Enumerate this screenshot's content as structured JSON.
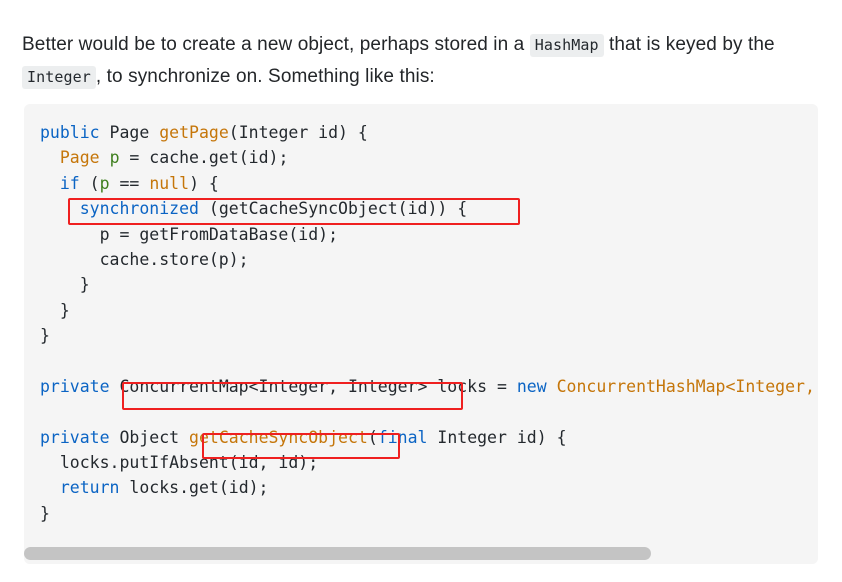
{
  "paragraph": {
    "part1": "Better would be to create a new object, perhaps stored in a ",
    "code1": "HashMap",
    "part2": " that is keyed by the ",
    "code2": "Integer",
    "part3": ", to synchronize on. Something like this:"
  },
  "code_block": {
    "language": "java",
    "lines": [
      {
        "tokens": [
          {
            "t": "public",
            "c": "kw"
          },
          {
            "t": " ",
            "c": "pln"
          },
          {
            "t": "Page",
            "c": "pln"
          },
          {
            "t": " ",
            "c": "pln"
          },
          {
            "t": "getPage",
            "c": "fn"
          },
          {
            "t": "(Integer id) {",
            "c": "pln"
          }
        ]
      },
      {
        "tokens": [
          {
            "t": "  ",
            "c": "pln"
          },
          {
            "t": "Page",
            "c": "typ"
          },
          {
            "t": " ",
            "c": "pln"
          },
          {
            "t": "p",
            "c": "var"
          },
          {
            "t": " = cache.get(id);",
            "c": "pln"
          }
        ]
      },
      {
        "tokens": [
          {
            "t": "  ",
            "c": "pln"
          },
          {
            "t": "if",
            "c": "kw"
          },
          {
            "t": " (",
            "c": "pln"
          },
          {
            "t": "p",
            "c": "var"
          },
          {
            "t": " == ",
            "c": "pln"
          },
          {
            "t": "null",
            "c": "typ"
          },
          {
            "t": ") {",
            "c": "pln"
          }
        ]
      },
      {
        "tokens": [
          {
            "t": "    ",
            "c": "pln"
          },
          {
            "t": "synchronized",
            "c": "kw"
          },
          {
            "t": " (getCacheSyncObject(id)) {",
            "c": "pln"
          }
        ]
      },
      {
        "tokens": [
          {
            "t": "      p = getFromDataBase(id);",
            "c": "pln"
          }
        ]
      },
      {
        "tokens": [
          {
            "t": "      cache.store(p);",
            "c": "pln"
          }
        ]
      },
      {
        "tokens": [
          {
            "t": "    }",
            "c": "pln"
          }
        ]
      },
      {
        "tokens": [
          {
            "t": "  }",
            "c": "pln"
          }
        ]
      },
      {
        "tokens": [
          {
            "t": "}",
            "c": "pln"
          }
        ]
      },
      {
        "tokens": [
          {
            "t": "",
            "c": "pln"
          }
        ]
      },
      {
        "tokens": [
          {
            "t": "private",
            "c": "kw"
          },
          {
            "t": " ConcurrentMap<Integer, Integer> locks = ",
            "c": "pln"
          },
          {
            "t": "new",
            "c": "kw"
          },
          {
            "t": " ",
            "c": "pln"
          },
          {
            "t": "ConcurrentHashMap<Integer, Integer>();",
            "c": "typ"
          }
        ]
      },
      {
        "tokens": [
          {
            "t": "",
            "c": "pln"
          }
        ]
      },
      {
        "tokens": [
          {
            "t": "private",
            "c": "kw"
          },
          {
            "t": " Object ",
            "c": "pln"
          },
          {
            "t": "getCacheSyncObject",
            "c": "fn"
          },
          {
            "t": "(",
            "c": "pln"
          },
          {
            "t": "final",
            "c": "kw"
          },
          {
            "t": " Integer id) {",
            "c": "pln"
          }
        ]
      },
      {
        "tokens": [
          {
            "t": "  locks.putIfAbsent(id, id);",
            "c": "pln"
          }
        ]
      },
      {
        "tokens": [
          {
            "t": "  ",
            "c": "pln"
          },
          {
            "t": "return",
            "c": "kw"
          },
          {
            "t": " locks.get(id);",
            "c": "pln"
          }
        ]
      },
      {
        "tokens": [
          {
            "t": "}",
            "c": "pln"
          }
        ]
      }
    ]
  },
  "annotations": {
    "boxes": [
      {
        "id": "box-sync",
        "label": "synchronized (getCacheSyncObject(id)) {",
        "color": "#ef2020"
      },
      {
        "id": "box-cmap",
        "label": "ConcurrentMap<Integer, Integer>",
        "color": "#ef2020"
      },
      {
        "id": "box-getobj",
        "label": "getCacheSyncObject",
        "color": "#ef2020"
      }
    ]
  },
  "scrollbar": {
    "orientation": "horizontal",
    "thumb_position_percent": 0,
    "thumb_width_percent": 79
  },
  "colors": {
    "page_background": "#ffffff",
    "code_background": "#f5f5f5",
    "inline_code_background": "#eceeef",
    "text": "#232629",
    "keyword": "#0b64c4",
    "type": "#c5760a",
    "variable": "#3f7f1e",
    "annotation": "#ef2020",
    "scrollbar_thumb": "#c4c4c4"
  }
}
